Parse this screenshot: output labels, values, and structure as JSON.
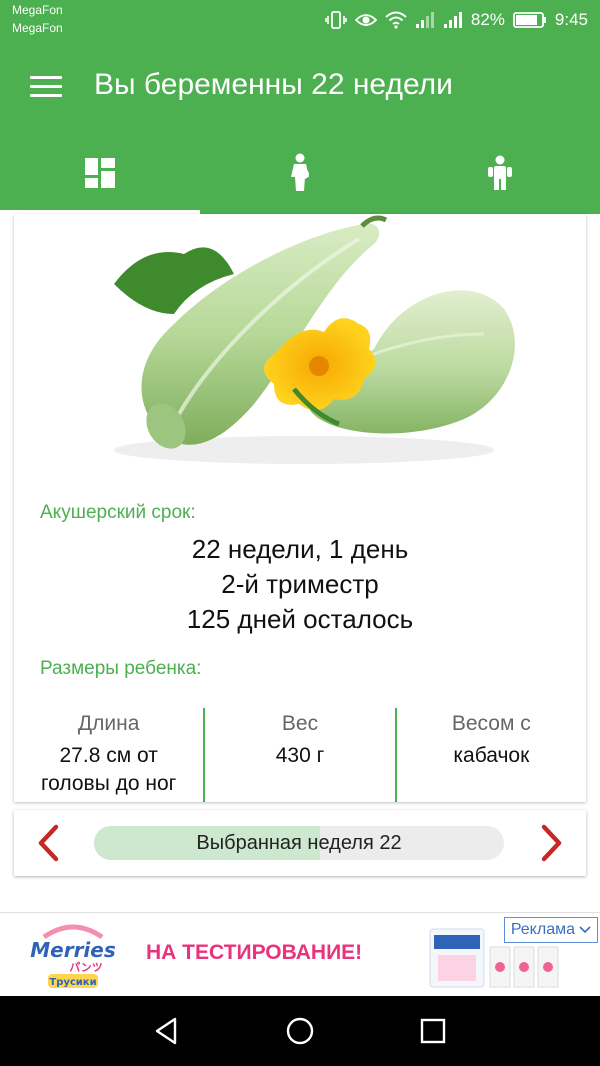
{
  "status_bar": {
    "carrier_1": "MegaFon",
    "carrier_2": "MegaFon",
    "battery": "82%",
    "time": "9:45",
    "icons": [
      "vibrate-icon",
      "eye-icon",
      "wifi-icon",
      "signal-icon",
      "signal-icon",
      "battery-icon"
    ]
  },
  "app_bar": {
    "title": "Вы беременны 22 недели",
    "menu_icon": "hamburger-menu-icon"
  },
  "tabs": [
    {
      "icon": "dashboard-icon",
      "active": true
    },
    {
      "icon": "mother-icon",
      "active": false
    },
    {
      "icon": "child-icon",
      "active": false
    }
  ],
  "term": {
    "label": "Акушерский срок:",
    "line_1": "22 недели, 1 день",
    "line_2": "2-й триместр",
    "line_3": "125 дней осталось"
  },
  "sizes": {
    "label": "Размеры ребенка:",
    "length_head": "Длина",
    "length_val_1": "27.8 см от",
    "length_val_2": "головы до ног",
    "weight_head": "Вес",
    "weight_val": "430 г",
    "compare_head": "Весом с",
    "compare_val": "кабачок"
  },
  "week_nav": {
    "label": "Выбранная неделя 22",
    "progress_fraction": 0.55
  },
  "ad": {
    "brand": "Merries",
    "brand_sub": "パンツ",
    "brand_sub2": "Трусики",
    "text": "НА ТЕСТИРОВАНИЕ!",
    "badge": "Реклама"
  },
  "colors": {
    "primary": "#4caf50",
    "accent_red": "#c62828",
    "ad_pink": "#e8337f"
  }
}
